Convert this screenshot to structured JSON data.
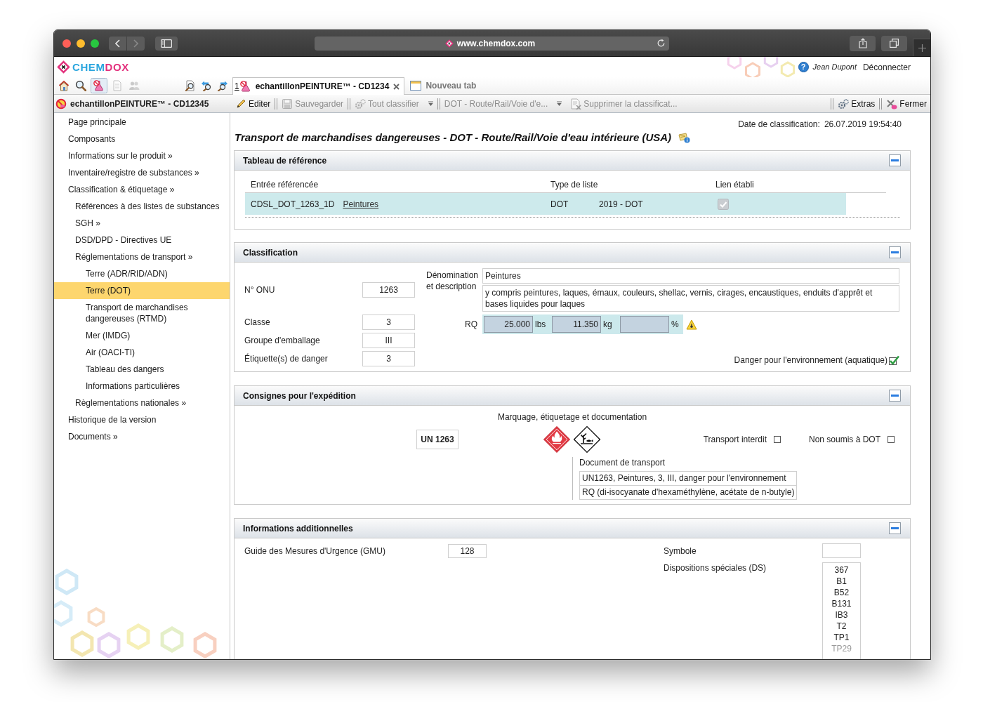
{
  "browser": {
    "url": "www.chemdox.com",
    "forward_disabled": true
  },
  "header": {
    "logo": [
      {
        "text": "CHEM",
        "color": "#2ba6de"
      },
      {
        "text": "DOX",
        "color": "#e3317d"
      }
    ],
    "help": "?",
    "user": "Jean Dupont",
    "logout": "Déconnecter"
  },
  "module_icons": [
    {
      "kind": "home",
      "selected": false,
      "disabled": false
    },
    {
      "kind": "search",
      "selected": false,
      "disabled": false
    },
    {
      "kind": "product",
      "selected": true,
      "disabled": false
    },
    {
      "kind": "document",
      "selected": false,
      "disabled": true
    },
    {
      "kind": "users",
      "selected": false,
      "disabled": true
    }
  ],
  "find_icons": [
    {
      "kind": "find"
    },
    {
      "kind": "find_previous"
    },
    {
      "kind": "find_next"
    }
  ],
  "tabs": [
    {
      "kind": "record",
      "number": "1",
      "label": "echantillonPEINTURE™ - CD1234",
      "selected": true,
      "closable": true
    },
    {
      "kind": "new",
      "label": "Nouveau tab",
      "selected": false
    }
  ],
  "record_title": "echantillonPEINTURE™ - CD12345",
  "toolbar": {
    "left": [
      [
        {
          "kind": "edit",
          "label": "Editer",
          "disabled": false
        }
      ],
      [
        {
          "kind": "save",
          "label": "Sauvegarder",
          "disabled": true
        }
      ],
      [
        {
          "kind": "classify",
          "label": "Tout classifier",
          "disabled": true,
          "has_menu": true
        }
      ],
      [
        {
          "kind": "text",
          "label": "DOT - Route/Rail/Voie d'e...",
          "disabled": true,
          "has_menu": true
        },
        {
          "kind": "delete",
          "label": "Supprimer la classificat...",
          "disabled": true
        }
      ]
    ],
    "right": [
      [
        {
          "kind": "extras",
          "label": "Extras",
          "disabled": false
        }
      ],
      [
        {
          "kind": "close",
          "label": "Fermer",
          "disabled": false
        }
      ]
    ]
  },
  "sidebar": {
    "items": [
      {
        "label": "Page principale",
        "selected": false
      },
      {
        "label": "Composants",
        "selected": false
      },
      {
        "label": "Informations sur le produit »",
        "selected": false
      },
      {
        "label": "Inventaire/registre de substances »",
        "selected": false
      },
      {
        "label": "Classification & étiquetage »",
        "selected": false,
        "children": [
          {
            "label": "Références à des listes de substances",
            "selected": false
          },
          {
            "label": "SGH »",
            "selected": false
          },
          {
            "label": "DSD/DPD - Directives UE",
            "selected": false
          },
          {
            "label": "Réglementations de transport »",
            "selected": false,
            "children": [
              {
                "label": "Terre (ADR/RID/ADN)",
                "selected": false
              },
              {
                "label": "Terre (DOT)",
                "selected": true
              },
              {
                "label": "Transport de marchandises dangereuses (RTMD)",
                "selected": false
              },
              {
                "label": "Mer (IMDG)",
                "selected": false
              },
              {
                "label": "Air (OACI-TI)",
                "selected": false
              },
              {
                "label": "Tableau des dangers",
                "selected": false
              },
              {
                "label": "Informations particulières",
                "selected": false
              }
            ]
          },
          {
            "label": "Règlementations nationales »",
            "selected": false
          }
        ]
      },
      {
        "label": "Historique de la version",
        "selected": false
      },
      {
        "label": "Documents »",
        "selected": false
      }
    ]
  },
  "classification_date": {
    "label": "Date de classification:",
    "value": "26.07.2019 19:54:40"
  },
  "page_title": "Transport de marchandises dangereuses - DOT - Route/Rail/Voie d'eau intérieure (USA)",
  "reference_table": {
    "title": "Tableau de référence",
    "expanded": true,
    "columns": [
      "Entrée référencée",
      "Type de liste",
      "Lien établi"
    ],
    "rows": [
      {
        "entry": "CDSL_DOT_1263_1D",
        "link": "Peintures",
        "list_type": "DOT",
        "list": "2019 - DOT",
        "linked": true,
        "selected": true
      }
    ]
  },
  "classification": {
    "title": "Classification",
    "expanded": true,
    "fields": [
      {
        "label": "N° ONU",
        "value": "1263"
      },
      {
        "label": "Classe",
        "value": "3"
      },
      {
        "label": "Groupe d'emballage",
        "value": "III"
      },
      {
        "label": "Étiquette(s) de danger",
        "value": "3"
      }
    ],
    "name_label": "Dénomination et description",
    "name": "Peintures",
    "description": "y compris peintures, laques, émaux, couleurs, shellac, vernis, cirages, encaustiques, enduits d'apprêt et bases liquides pour laques",
    "rq": {
      "label": "RQ",
      "quantities": [
        {
          "value": "25.000",
          "unit": "lbs"
        },
        {
          "value": "11.350",
          "unit": "kg"
        },
        {
          "unit": "%"
        }
      ],
      "warning": true
    },
    "environment_hazard": {
      "label": "Danger pour l'environnement (aquatique)",
      "checked": true
    }
  },
  "shipping": {
    "title": "Consignes pour l'expédition",
    "expanded": true,
    "heading": "Marquage, étiquetage et documentation",
    "un_mark": "UN 1263",
    "pictograms": [
      {
        "kind": "flammable"
      },
      {
        "kind": "environment"
      }
    ],
    "options": [
      {
        "label": "Transport interdit",
        "checked": false
      },
      {
        "label": "Non soumis à DOT",
        "checked": false
      }
    ],
    "transport_document": {
      "label": "Document de transport",
      "lines": [
        "UN1263, Peintures, 3, III, danger pour l'environnement",
        "RQ (di-isocyanate d'hexaméthylène, acétate de n-butyle)"
      ]
    }
  },
  "additional_info": {
    "title": "Informations additionnelles",
    "expanded": true,
    "gmu": {
      "label": "Guide des Mesures d'Urgence (GMU)",
      "value": "128"
    },
    "symbol": {
      "label": "Symbole"
    },
    "special_provisions": {
      "label": "Dispositions spéciales (DS)",
      "items": [
        "367",
        "B1",
        "B52",
        "B131",
        "IB3",
        "T2",
        "TP1",
        "TP29"
      ]
    }
  }
}
